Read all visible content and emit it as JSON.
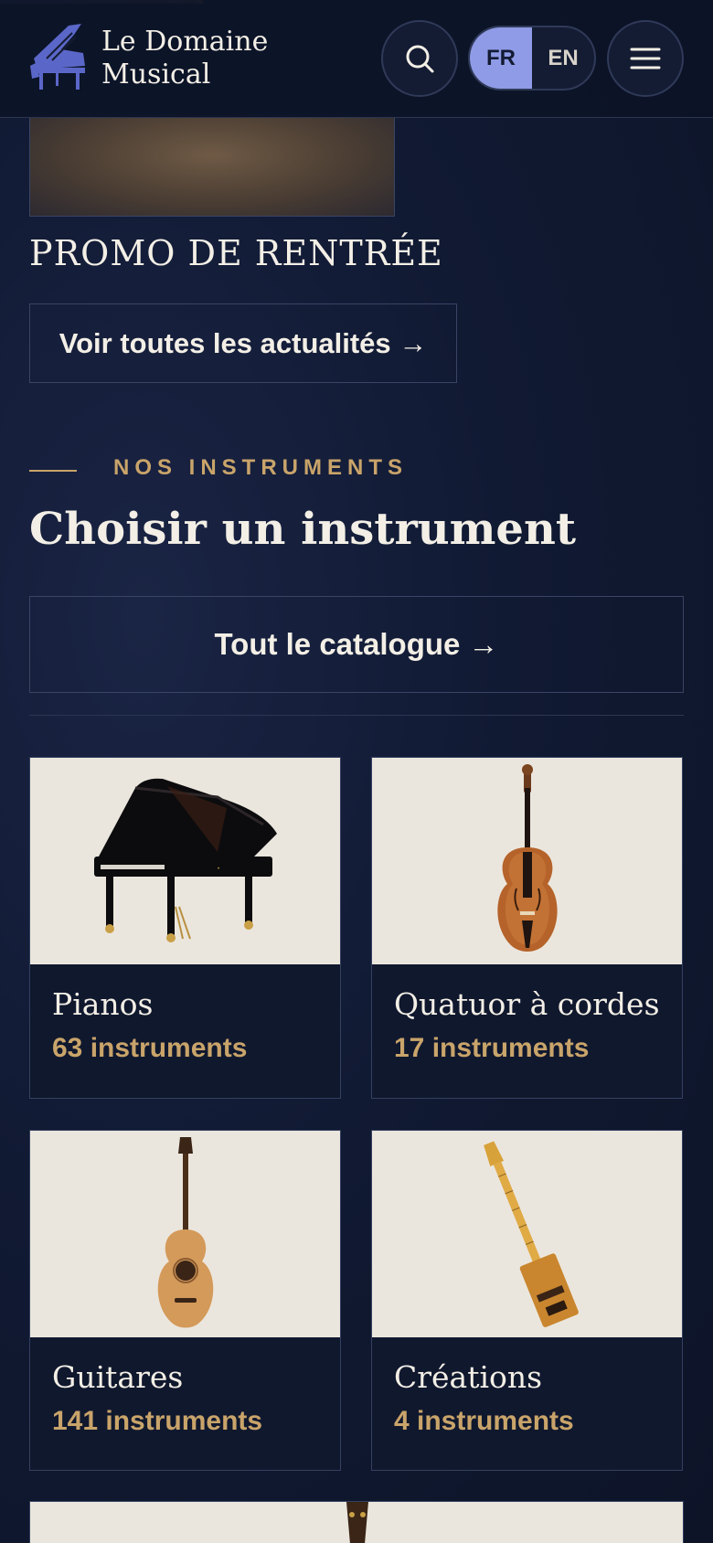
{
  "header": {
    "brand_line1": "Le Domaine",
    "brand_line2": "Musical",
    "logo_icon": "grand-piano-logo",
    "search_icon": "search-icon",
    "menu_icon": "hamburger-menu-icon",
    "languages": [
      {
        "code": "FR",
        "active": true
      },
      {
        "code": "EN",
        "active": false
      }
    ]
  },
  "news": {
    "promo_title": "PROMO DE RENTRÉE",
    "all_news_label": "Voir toutes les actualités →"
  },
  "instruments": {
    "eyebrow": "NOS INSTRUMENTS",
    "title": "Choisir un instrument",
    "catalog_label": "Tout le catalogue →",
    "categories": [
      {
        "name": "Pianos",
        "count": "63 instruments",
        "image": "grand-piano"
      },
      {
        "name": "Quatuor à cordes",
        "count": "17 instruments",
        "image": "violin"
      },
      {
        "name": "Guitares",
        "count": "141 instruments",
        "image": "acoustic-guitar"
      },
      {
        "name": "Créations",
        "count": "4 instruments",
        "image": "cigar-box-guitar"
      }
    ]
  },
  "colors": {
    "background": "#111a33",
    "accent_gold": "#c9a46a",
    "accent_lavender": "#8f9be6",
    "text": "#f3efe6"
  }
}
